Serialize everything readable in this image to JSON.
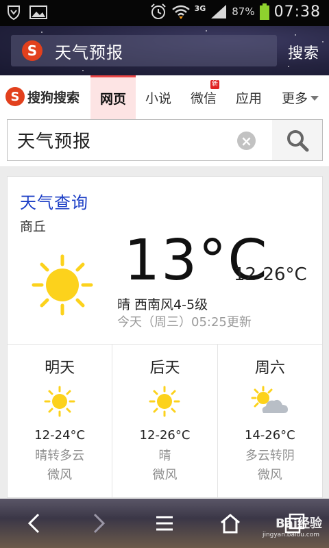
{
  "status_bar": {
    "network": "3G",
    "battery": "87%",
    "time": "07:38"
  },
  "top_header": {
    "query": "天气预报",
    "search_label": "搜索"
  },
  "tabs_bar": {
    "brand": "搜狗搜索",
    "tabs": [
      {
        "label": "网页",
        "active": true
      },
      {
        "label": "小说"
      },
      {
        "label": "微信",
        "badge": "新"
      },
      {
        "label": "应用"
      },
      {
        "label": "更多"
      }
    ]
  },
  "search": {
    "value": "天气预报",
    "placeholder": ""
  },
  "weather": {
    "title": "天气查询",
    "city": "商丘",
    "current_temp": "13°C",
    "temp_range": "12-26°C",
    "condition": "晴 西南风4-5级",
    "updated": "今天（周三）05:25更新",
    "forecast": [
      {
        "day": "明天",
        "temp": "12-24°C",
        "condition": "晴转多云",
        "wind": "微风",
        "icon": "sun-icon"
      },
      {
        "day": "后天",
        "temp": "12-26°C",
        "condition": "晴",
        "wind": "微风",
        "icon": "sun-icon"
      },
      {
        "day": "周六",
        "temp": "14-26°C",
        "condition": "多云转阴",
        "wind": "微风",
        "icon": "sun-cloud-icon"
      }
    ]
  },
  "bottom_bar": {
    "watermark": "Bai经验",
    "watermark_url": "jingyan.baidu.com"
  },
  "colors": {
    "accent_red": "#e2401d",
    "title_blue": "#1d3fc6",
    "sun_yellow": "#fcd21c",
    "battery_green": "#8ed22e"
  }
}
